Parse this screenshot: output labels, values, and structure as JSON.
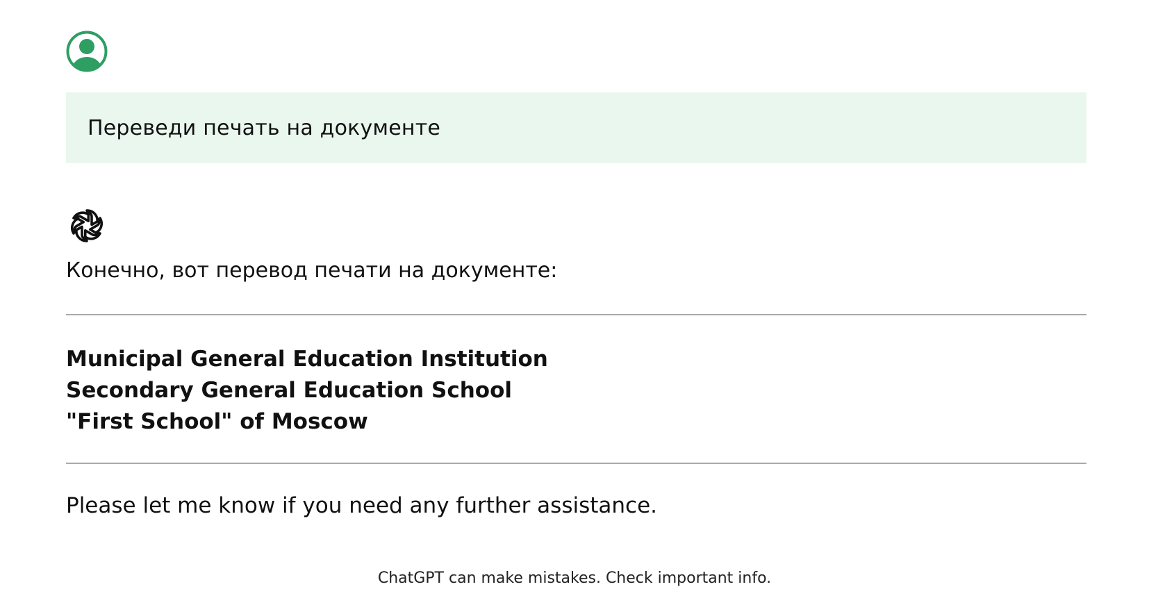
{
  "conversation": {
    "user": {
      "avatar_icon": "user-avatar-icon",
      "avatar_color": "#2e9e63",
      "bubble_color": "#eaf7ef",
      "message": "Переведи печать на документе"
    },
    "assistant": {
      "logo_icon": "chatgpt-logo-icon",
      "intro": "Конечно, вот перевод печати на документе:",
      "stamp_translation": [
        "Municipal General Education Institution",
        "Secondary General Education School",
        "\"First School\" of Moscow"
      ],
      "closing": "Please let me know if you need any further assistance."
    }
  },
  "footer": {
    "disclaimer": "ChatGPT can make mistakes. Check important info."
  }
}
